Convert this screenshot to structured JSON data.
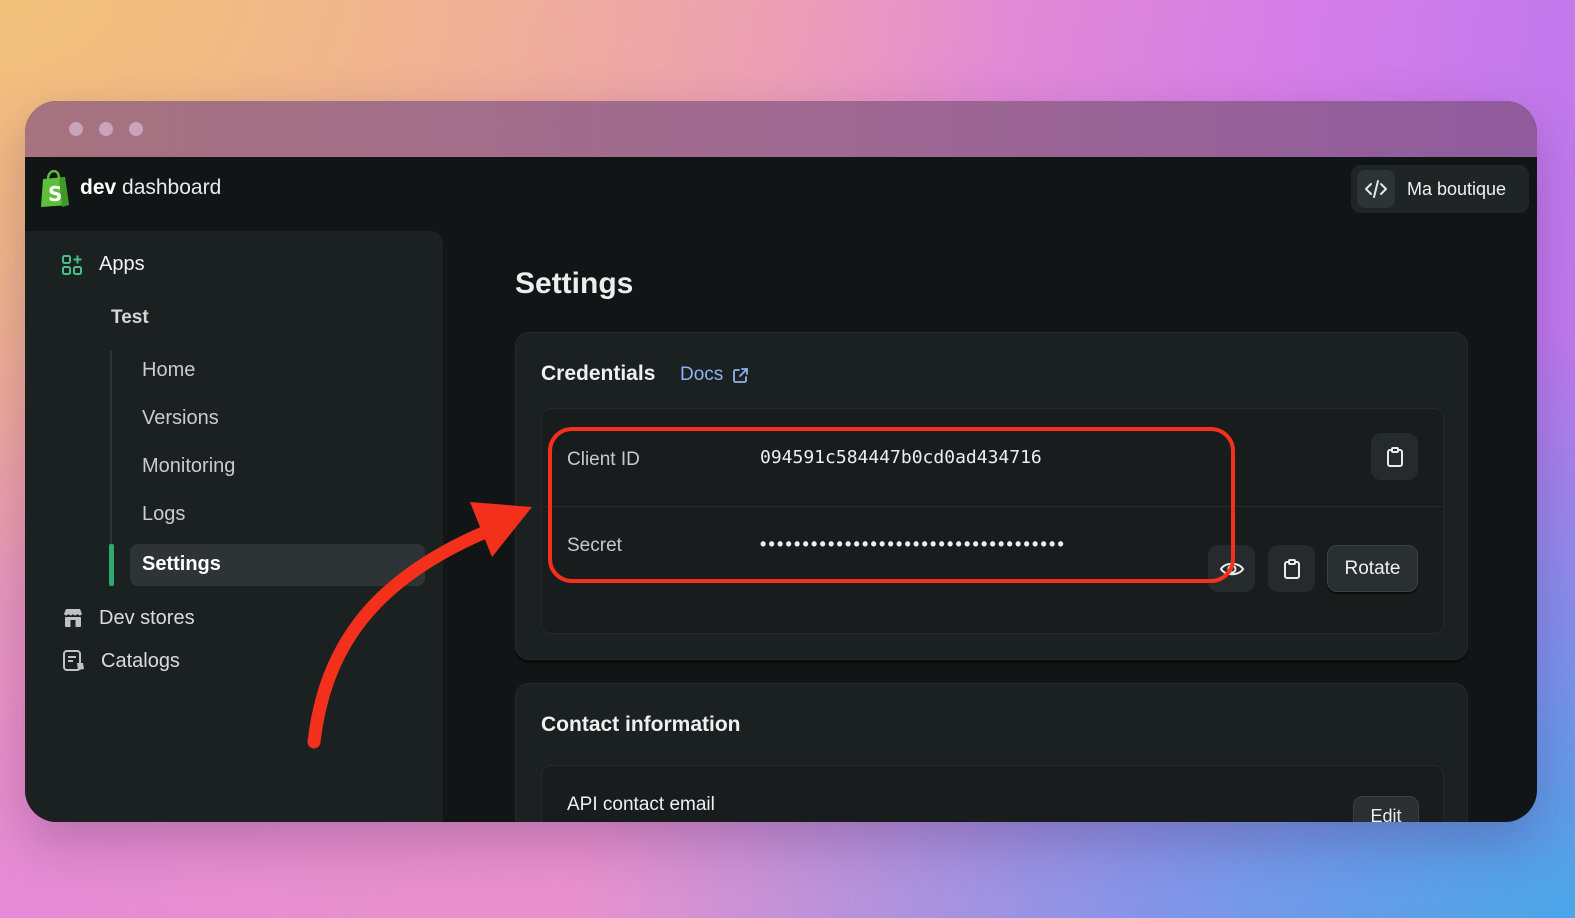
{
  "header": {
    "brand_bold": "dev",
    "brand_rest": " dashboard",
    "store_name": "Ma boutique"
  },
  "sidebar": {
    "apps_label": "Apps",
    "app_name": "Test",
    "subnav": [
      "Home",
      "Versions",
      "Monitoring",
      "Logs",
      "Settings"
    ],
    "active_item": "Settings",
    "dev_stores_label": "Dev stores",
    "catalogs_label": "Catalogs"
  },
  "main": {
    "page_title": "Settings",
    "credentials": {
      "title": "Credentials",
      "docs_label": "Docs",
      "client_id_label": "Client ID",
      "client_id_value": "094591c584447b0cd0ad434716",
      "secret_label": "Secret",
      "secret_value": "••••••••••••••••••••••••••••••••••••",
      "rotate_label": "Rotate"
    },
    "contact": {
      "title": "Contact information",
      "api_email_label": "API contact email",
      "edit_label": "Edit"
    }
  },
  "colors": {
    "accent_green": "#2dab6e",
    "link_blue": "#8fb3ef",
    "annotation_red": "#f2301b"
  }
}
